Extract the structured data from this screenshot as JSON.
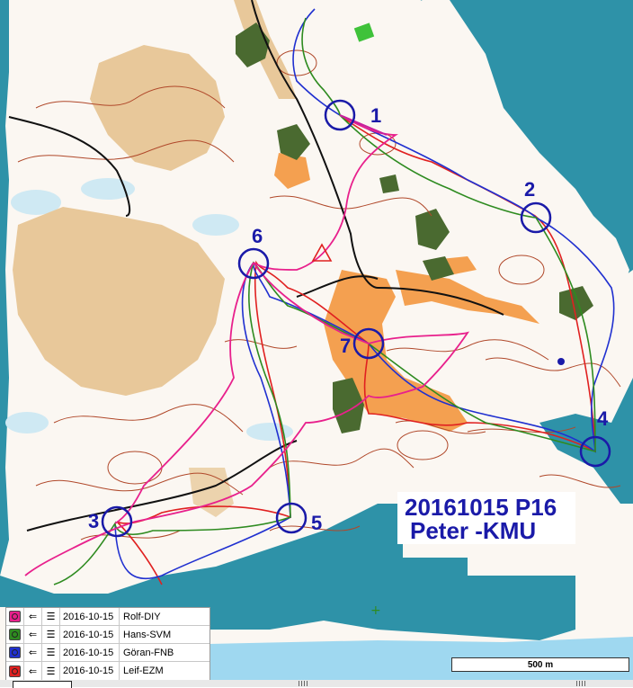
{
  "event": {
    "title_line1": "20161015 P16",
    "title_line2": "Peter -KMU"
  },
  "controls": [
    {
      "label": "1",
      "kind": "control"
    },
    {
      "label": "2",
      "kind": "control"
    },
    {
      "label": "3",
      "kind": "control"
    },
    {
      "label": "4",
      "kind": "control"
    },
    {
      "label": "5",
      "kind": "control"
    },
    {
      "label": "6",
      "kind": "control"
    },
    {
      "label": "7",
      "kind": "control"
    }
  ],
  "runners": [
    {
      "date": "2016-10-15",
      "name": "Rolf-DIY",
      "color": "#e8208c"
    },
    {
      "date": "2016-10-15",
      "name": "Hans-SVM",
      "color": "#2e8b20"
    },
    {
      "date": "2016-10-15",
      "name": "Göran-FNB",
      "color": "#2030d0"
    },
    {
      "date": "2016-10-15",
      "name": "Leif-EZM",
      "color": "#e02020"
    }
  ],
  "scale": {
    "label": "500 m"
  },
  "colors": {
    "water": "#2e92a8",
    "lake_light": "#9fd8f0",
    "open_land": "#e8c89a",
    "field": "#f4a050",
    "vegetation": "#4a6a30",
    "contour": "#b0482a",
    "course": "#1a1aa8"
  },
  "icons": {
    "row_arrow": "left-arrow-icon",
    "row_list": "list-icon",
    "map_marker": "plus-icon"
  }
}
